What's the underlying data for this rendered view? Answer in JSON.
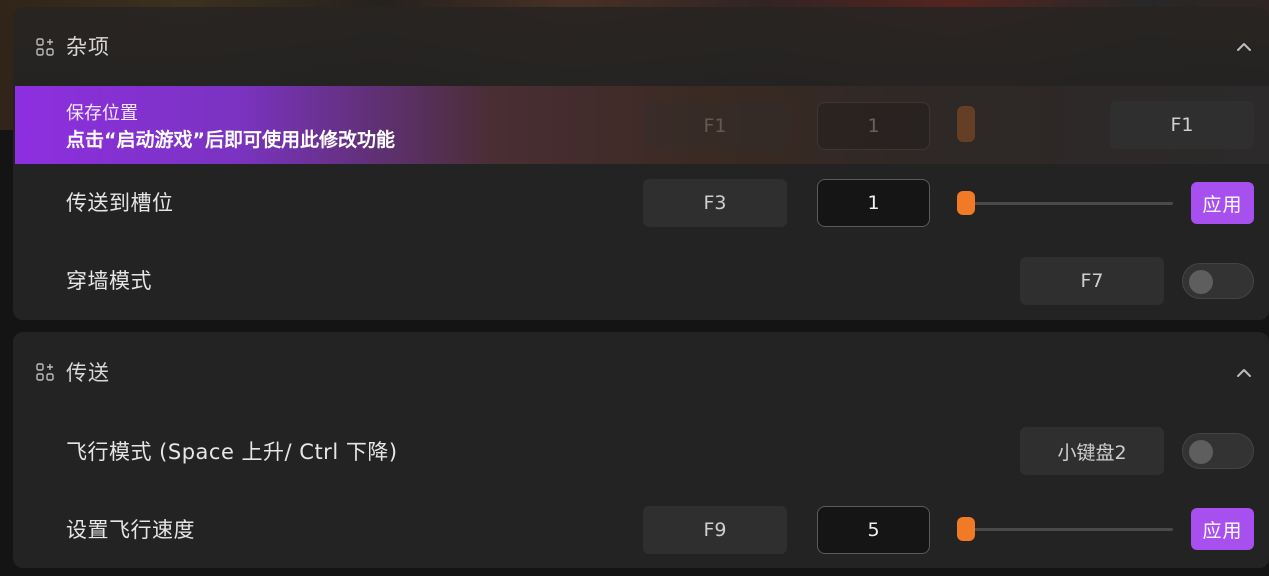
{
  "sections": {
    "misc": {
      "title": "杂项",
      "rows": {
        "save_position": {
          "label": "保存位置",
          "notice": "点击“启动游戏”后即可使用此修改功能",
          "hotkey": "F1",
          "value": "1",
          "action_hotkey": "F1"
        },
        "teleport_slot": {
          "label": "传送到槽位",
          "hotkey": "F3",
          "value": "1",
          "slider_fraction": 0,
          "apply_label": "应用"
        },
        "wall_mode": {
          "label": "穿墙模式",
          "hotkey": "F7",
          "toggle_on": false
        }
      }
    },
    "teleport": {
      "title": "传送",
      "rows": {
        "fly_mode": {
          "label": "飞行模式 (Space 上升/ Ctrl 下降)",
          "hotkey": "小键盘2",
          "toggle_on": false
        },
        "fly_speed": {
          "label": "设置飞行速度",
          "hotkey": "F9",
          "value": "5",
          "slider_fraction": 0,
          "apply_label": "应用"
        }
      }
    }
  },
  "icons": {
    "section_icon": "apps-add-icon",
    "collapse_icon": "chevron-up-icon"
  },
  "colors": {
    "accent_purple": "#a84ff0",
    "slider_orange": "#f07a25",
    "highlight_gradient_start": "#8e2fe0"
  }
}
